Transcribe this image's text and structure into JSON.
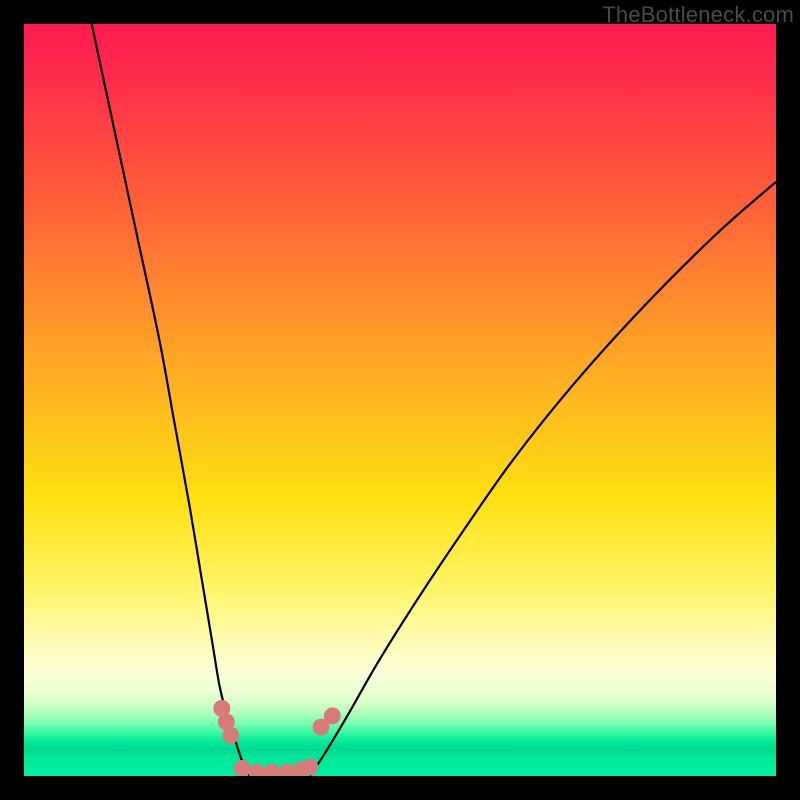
{
  "watermark": "TheBottleneck.com",
  "chart_data": {
    "type": "line",
    "title": "",
    "xlabel": "",
    "ylabel": "",
    "xlim": [
      0,
      100
    ],
    "ylim": [
      0,
      100
    ],
    "series": [
      {
        "name": "left-curve",
        "x": [
          9,
          12,
          15,
          18,
          20,
          22,
          23.5,
          25,
          26,
          27,
          28,
          29,
          30
        ],
        "y": [
          100,
          86,
          72,
          58,
          47,
          36,
          27,
          18,
          12,
          8,
          5,
          2,
          0
        ]
      },
      {
        "name": "right-curve",
        "x": [
          38,
          40,
          43,
          47,
          52,
          58,
          65,
          73,
          82,
          92,
          100
        ],
        "y": [
          0,
          3,
          8,
          15,
          23,
          32,
          42,
          52,
          62,
          72,
          79
        ]
      },
      {
        "name": "trough-floor",
        "x": [
          30,
          32,
          34,
          36,
          38
        ],
        "y": [
          0,
          0,
          0,
          0,
          0
        ]
      }
    ],
    "markers": [
      {
        "name": "left-cluster-1",
        "x": 26.3,
        "y": 9.0
      },
      {
        "name": "left-cluster-2",
        "x": 26.9,
        "y": 7.2
      },
      {
        "name": "left-cluster-3",
        "x": 27.5,
        "y": 5.4
      },
      {
        "name": "right-cluster-1",
        "x": 39.5,
        "y": 6.5
      },
      {
        "name": "right-cluster-2",
        "x": 41.0,
        "y": 8.0
      },
      {
        "name": "bottom-1",
        "x": 29.0,
        "y": 1.0
      },
      {
        "name": "bottom-2",
        "x": 31.0,
        "y": 0.5
      },
      {
        "name": "bottom-3",
        "x": 33.0,
        "y": 0.5
      },
      {
        "name": "bottom-4",
        "x": 35.0,
        "y": 0.5
      },
      {
        "name": "bottom-5",
        "x": 36.8,
        "y": 0.8
      },
      {
        "name": "bottom-6",
        "x": 38.0,
        "y": 1.2
      }
    ],
    "colors": {
      "curve": "#000000",
      "marker": "#d77b79"
    }
  }
}
